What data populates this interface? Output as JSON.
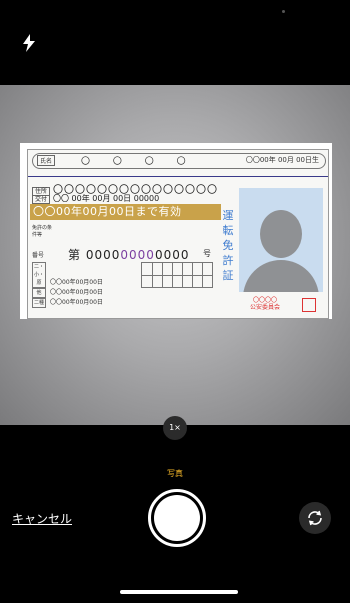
{
  "card": {
    "name_label": "氏名",
    "name": "〇 〇 〇 〇",
    "birth": "〇〇00年 00月 00日生",
    "address_label": "住所",
    "address": "〇〇〇〇〇〇〇〇〇〇〇〇〇〇〇",
    "issue_label": "交付",
    "issue": "〇〇 00年 00月 00日 00000",
    "validity": "〇〇00年00月00日まで有効",
    "conditions": "免許の条件等",
    "vertical_title": [
      "運",
      "転",
      "免",
      "許",
      "証"
    ],
    "number_label": "番号",
    "number_prefix": "第",
    "number_a": "0000",
    "number_purple": "0000",
    "number_b": "0000",
    "number_suffix": "号",
    "dates": [
      {
        "k": "二・小・原",
        "v": "〇〇00年00月00日"
      },
      {
        "k": "他",
        "v": "〇〇00年00月00日"
      },
      {
        "k": "二種",
        "v": "〇〇00年00月00日"
      }
    ],
    "grid_label": "種類",
    "seal": "〇〇〇〇\n公安委員会"
  },
  "controls": {
    "zoom": "1×",
    "mode": "写真",
    "cancel": "キャンセル"
  },
  "icons": {
    "flash": "flash-icon",
    "flip": "flip-camera-icon"
  }
}
